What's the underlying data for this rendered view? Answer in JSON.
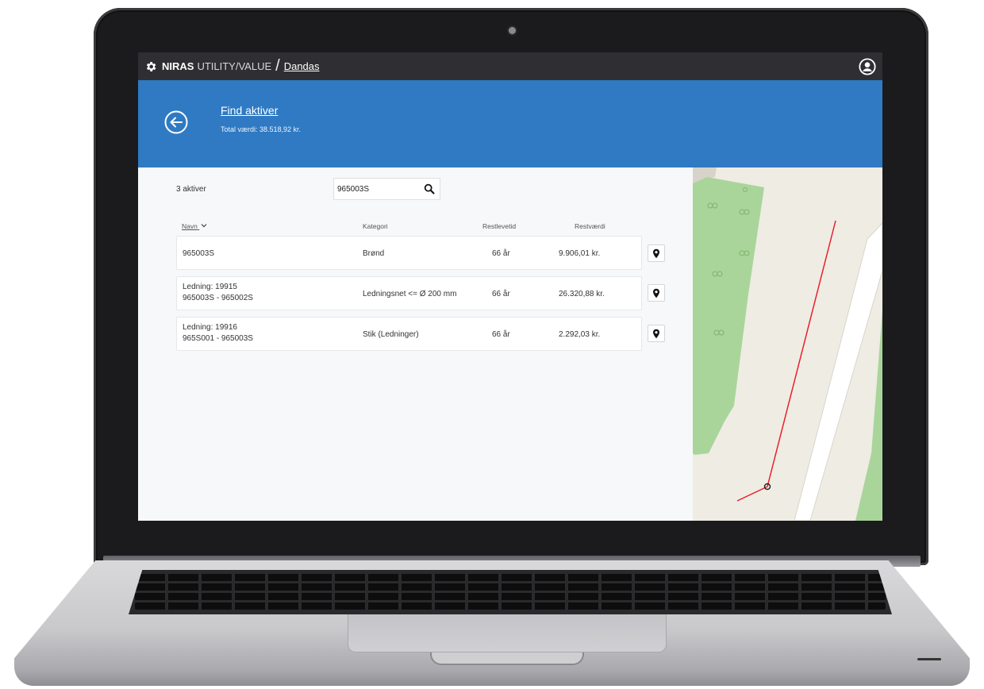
{
  "app": {
    "brand_strong": "NIRAS",
    "brand_rest": "UTILITY/VALUE",
    "separator": "/",
    "breadcrumb": "Dandas"
  },
  "header": {
    "title": "Find aktiver",
    "subtitle": "Total værdi: 38.518,92 kr."
  },
  "search": {
    "results_count": "3 aktiver",
    "value": "965003S"
  },
  "table": {
    "columns": {
      "navn": "Navn",
      "kategori": "Kategori",
      "restlevetid": "Restlevetid",
      "restvaerdi": "Restværdi"
    },
    "rows": [
      {
        "name_line1": "965003S",
        "name_line2": "",
        "kategori": "Brønd",
        "restlevetid": "66 år",
        "restvaerdi": "9.906,01 kr."
      },
      {
        "name_line1": "Ledning: 19915",
        "name_line2": "965003S - 965002S",
        "kategori": "Ledningsnet <= Ø 200 mm",
        "restlevetid": "66 år",
        "restvaerdi": "26.320,88 kr."
      },
      {
        "name_line1": "Ledning: 19916",
        "name_line2": "965S001 - 965003S",
        "kategori": "Stik (Ledninger)",
        "restlevetid": "66 år",
        "restvaerdi": "2.292,03 kr."
      }
    ]
  },
  "colors": {
    "topbar": "#2f2f33",
    "header": "#2f7ac3",
    "map_ground": "#efece4",
    "map_green": "#a9d59b",
    "pipe": "#e8202a"
  },
  "icons": [
    "gear-icon",
    "user-account-icon",
    "back-arrow-icon",
    "search-icon",
    "map-pin-icon",
    "chevron-down-icon"
  ]
}
